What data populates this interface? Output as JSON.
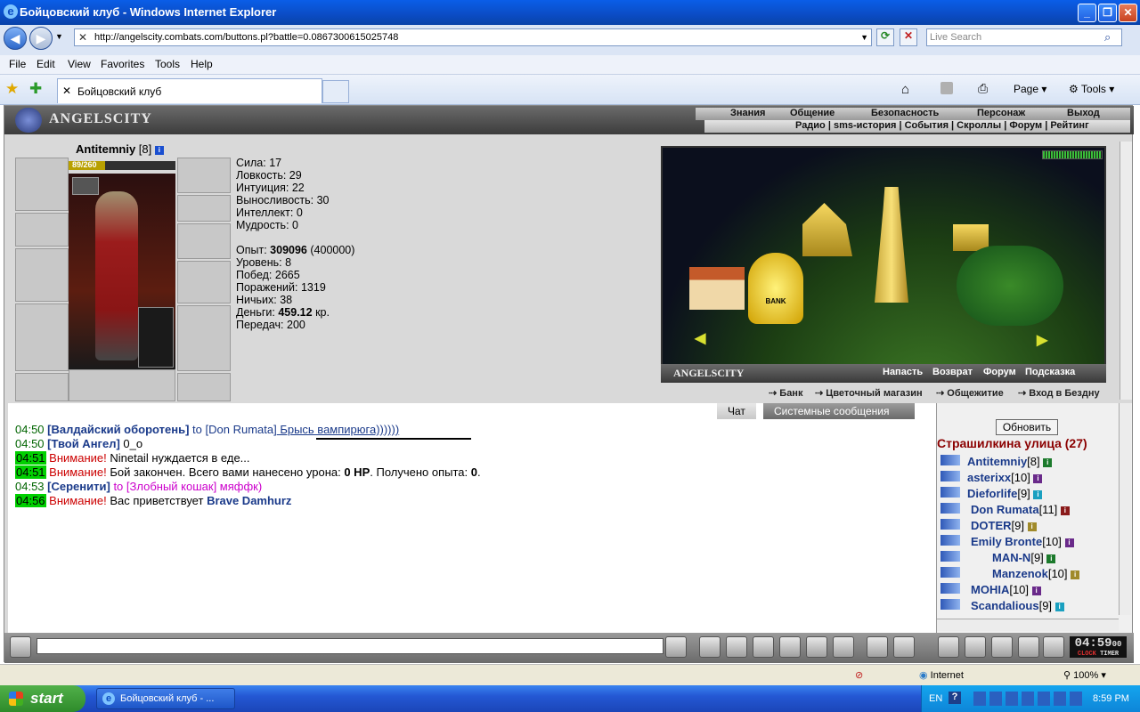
{
  "window": {
    "title": "Бойцовский клуб - Windows Internet Explorer"
  },
  "browser": {
    "url": "http://angelscity.combats.com/buttons.pl?battle=0.0867300615025748",
    "search_placeholder": "Live Search",
    "menu": [
      "File",
      "Edit",
      "View",
      "Favorites",
      "Tools",
      "Help"
    ],
    "tab_title": "Бойцовский клуб",
    "cmd_page": "Page",
    "cmd_tools": "Tools"
  },
  "game": {
    "logo": "ANGELSCITY",
    "top_menu": [
      "Знания",
      "Общение",
      "Безопасность",
      "Персонаж",
      "Выход"
    ],
    "sub_menu": "Радио | sms-история | События | Скроллы | Форум | Рейтинг",
    "character": {
      "name": "Antitemniy",
      "level": "[8]",
      "hp": "89/260",
      "hp_fraction": 0.342,
      "stats": [
        "Сила: 17",
        "Ловкость: 29",
        "Интуиция: 22",
        "Выносливость: 30",
        "Интеллект: 0",
        "Мудрость: 0"
      ],
      "exp_label": "Опыт:",
      "exp_value": "309096",
      "exp_next": "(400000)",
      "level_line": "Уровень: 8",
      "wins": "Побед: 2665",
      "losses": "Поражений: 1319",
      "draws": "Ничьих: 38",
      "money_label": "Деньги:",
      "money_value": "459.12",
      "money_unit": "кр.",
      "transfers": "Передач: 200"
    },
    "map": {
      "label": "ANGELSCITY",
      "links": [
        "Напасть",
        "Возврат",
        "Форум",
        "Подсказка"
      ],
      "bank_sign": "BANK"
    },
    "locations": [
      "Банк",
      "Цветочный магазин",
      "Общежитие",
      "Вход в Бездну"
    ],
    "chat_tabs": [
      "Чат",
      "Системные сообщения"
    ],
    "chat": [
      {
        "time": "04:50",
        "a": "[Валдайский оборотень]",
        "b": " to ",
        "c": "[Don Rumata]",
        "d": " Брысь вампирюга))))))"
      },
      {
        "time": "04:50",
        "a": "[Твой Ангел]",
        "b": " 0_o"
      },
      {
        "time": "04:51",
        "warn": "Внимание!",
        "text": " Ninetail нуждается в еде..."
      },
      {
        "time": "04:51",
        "warn": "Внимание!",
        "text": " Бой закончен. Всего вами нанесено урона: ",
        "b1": "0 HP",
        "text2": ". Получено опыта: ",
        "b2": "0",
        "text3": "."
      },
      {
        "time": "04:53",
        "a": "[Серенити]",
        "b": " to [Злобный кошак] мяффк)"
      },
      {
        "time": "04:56",
        "warn": "Внимание!",
        "text": " Вас приветствует ",
        "b1": "Brave Damhurz"
      }
    ],
    "online": {
      "refresh": "Обновить",
      "room": "Страшилкина улица (27)",
      "users": [
        {
          "name": "Antitemniy",
          "lvl": "[8]"
        },
        {
          "name": "asterixx",
          "lvl": "[10]"
        },
        {
          "name": "Dieforlife",
          "lvl": "[9]"
        },
        {
          "name": "Don Rumata",
          "lvl": "[11]"
        },
        {
          "name": "DOTER",
          "lvl": "[9]"
        },
        {
          "name": "Emily Bronte",
          "lvl": "[10]"
        },
        {
          "name": "MAN-N",
          "lvl": "[9]"
        },
        {
          "name": "Manzenok",
          "lvl": "[10]"
        },
        {
          "name": "MOHIA",
          "lvl": "[10]"
        },
        {
          "name": "Scandalious",
          "lvl": "[9]"
        }
      ]
    },
    "clock": "04:59",
    "clock_sec": "00",
    "clock_label": "CLOCK",
    "timer_label": "TIMER"
  },
  "statusbar": {
    "zone": "Internet",
    "zoom": "100%"
  },
  "taskbar": {
    "start": "start",
    "item": "Бойцовский клуб - ...",
    "lang": "EN",
    "time": "8:59 PM"
  }
}
